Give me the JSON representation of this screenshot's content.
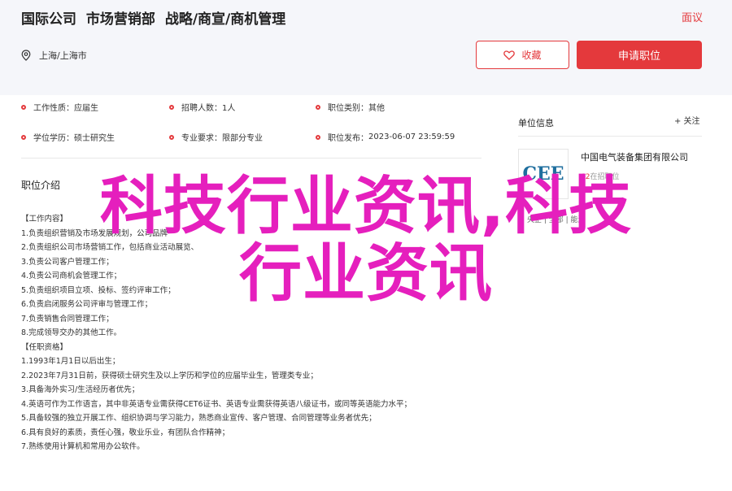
{
  "header": {
    "company": "国际公司",
    "department": "市场营销部",
    "position": "战略/商宣/商机管理",
    "report_label": "面议",
    "location": "上海/上海市",
    "favorite_label": "收藏",
    "apply_label": "申请职位"
  },
  "info": {
    "nature_label": "工作性质：",
    "nature_value": "应届生",
    "count_label": "招聘人数：",
    "count_value": "1人",
    "category_label": "职位类别：",
    "category_value": "其他",
    "education_label": "学位学历：",
    "education_value": "硕士研究生",
    "major_label": "专业要求：",
    "major_value": "限部分专业",
    "time_label": "职位发布：",
    "time_value": "2023-06-07 23:59:59"
  },
  "description": {
    "title": "职位介绍",
    "lines": [
      "【工作内容】",
      "1.负责组织营销及市场发展规划，公司品牌",
      "2.负责组织公司市场营销工作，包括商业活动展览、",
      "3.负责公司客户管理工作；",
      "4.负责公司商机会管理工作；",
      "5.负责组织项目立项、投标、签约评审工作；",
      "6.负责启闭服务公司评审与管理工作；",
      "7.负责销售合同管理工作；",
      "8.完成领导交办的其他工作。",
      "【任职资格】",
      "1.1993年1月1日以后出生；",
      "2.2023年7月31日前，获得硕士研究生及以上学历和学位的应届毕业生，管理类专业；",
      "3.具备海外实习/生活经历者优先；",
      "4.英语可作为工作语言，其中非英语专业需获得CET6证书、英语专业需获得英语八级证书，或同等英语能力水平；",
      "5.具备较强的独立开展工作、组织协调与学习能力，熟悉商业宣传、客户管理、合同管理等业务者优先；",
      "6.具有良好的素质，责任心强，敬业乐业，有团队合作精神；",
      "7.熟练使用计算机和常用办公软件。"
    ]
  },
  "sidebar": {
    "title": "单位信息",
    "follow_label": "+ 关注",
    "logo_text": "CEE",
    "company_name": "中国电气装备集团有限公司",
    "count": "62",
    "count_suffix": "在招职位",
    "tags": "央企 | 全部 | 能源"
  },
  "watermark": {
    "line1": "科技行业资讯,科技",
    "line2": "行业资讯"
  },
  "colors": {
    "accent": "#e4393c",
    "watermark": "#e51fbd",
    "header_bg": "#f5f6fa"
  }
}
